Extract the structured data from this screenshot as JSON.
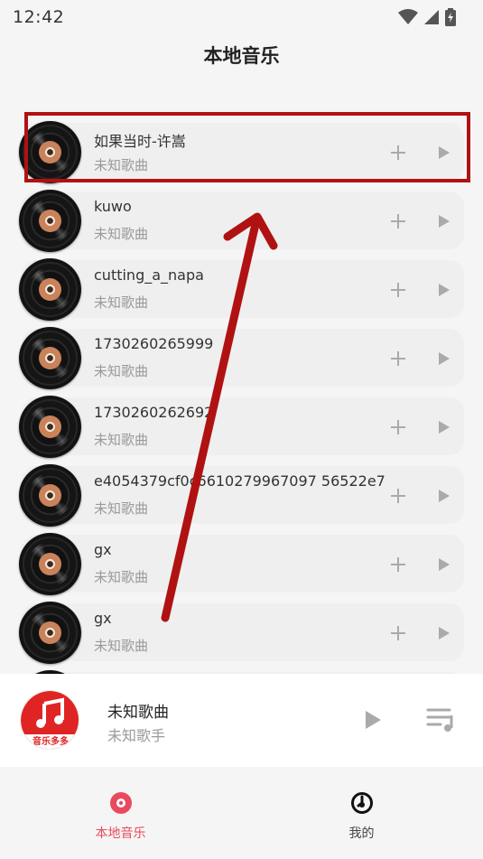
{
  "status_bar": {
    "time": "12:42"
  },
  "header": {
    "title": "本地音乐"
  },
  "songs": [
    {
      "title": "如果当时-许嵩",
      "subtitle": "未知歌曲"
    },
    {
      "title": "kuwo",
      "subtitle": "未知歌曲"
    },
    {
      "title": "cutting_a_napa",
      "subtitle": "未知歌曲"
    },
    {
      "title": "1730260265999",
      "subtitle": "未知歌曲"
    },
    {
      "title": "1730260262692",
      "subtitle": "未知歌曲"
    },
    {
      "title": "e4054379cf0c6610279967097 56522e7",
      "subtitle": "未知歌曲"
    },
    {
      "title": "gx",
      "subtitle": "未知歌曲"
    },
    {
      "title": "gx",
      "subtitle": "未知歌曲"
    }
  ],
  "now_playing": {
    "title": "未知歌曲",
    "artist": "未知歌手",
    "cover_text": "音乐多多"
  },
  "bottom_nav": {
    "items": [
      {
        "label": "本地音乐",
        "icon": "disc-icon",
        "active": true
      },
      {
        "label": "我的",
        "icon": "clock-disc-icon",
        "active": false
      }
    ]
  },
  "colors": {
    "accent": "#e84a5f",
    "annotation": "#b01212",
    "cover_red": "#e02424"
  }
}
